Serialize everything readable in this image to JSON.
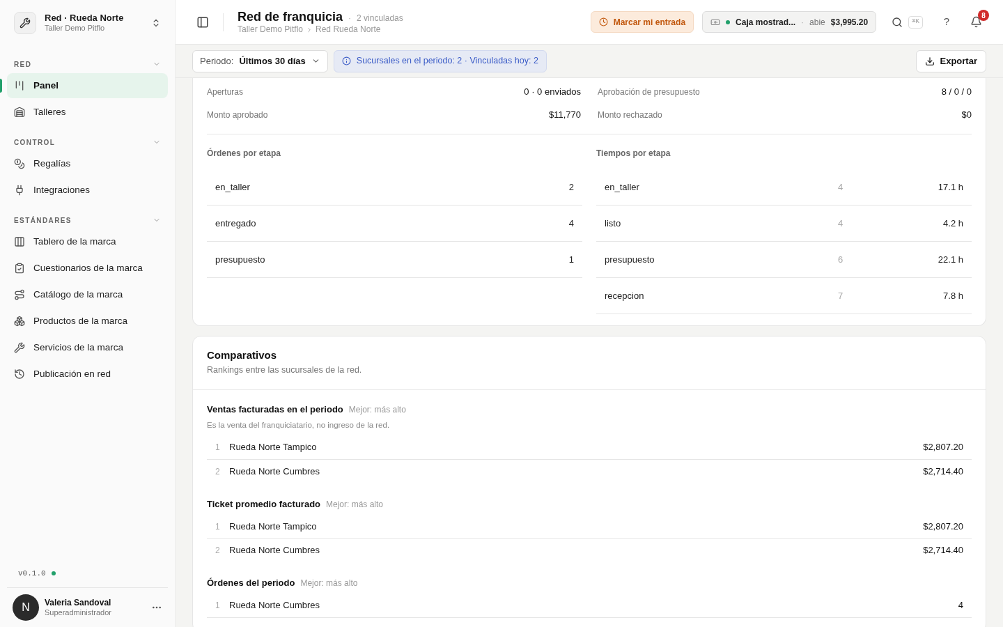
{
  "sidebar": {
    "org": {
      "title": "Red · Rueda Norte",
      "subtitle": "Taller Demo Pitflo"
    },
    "sections": [
      {
        "label": "RED",
        "expanded": true,
        "items": [
          {
            "label": "Panel",
            "selected": true
          },
          {
            "label": "Talleres",
            "selected": false
          }
        ]
      },
      {
        "label": "CONTROL",
        "expanded": true,
        "items": [
          {
            "label": "Regalías",
            "selected": false
          },
          {
            "label": "Integraciones",
            "selected": false
          }
        ]
      },
      {
        "label": "ESTÁNDARES",
        "expanded": true,
        "items": [
          {
            "label": "Tablero de la marca",
            "selected": false
          },
          {
            "label": "Cuestionarios de la marca",
            "selected": false
          },
          {
            "label": "Catálogo de la marca",
            "selected": false
          },
          {
            "label": "Productos de la marca",
            "selected": false
          },
          {
            "label": "Servicios de la marca",
            "selected": false
          },
          {
            "label": "Publicación en red",
            "selected": false
          }
        ]
      }
    ],
    "version": "v0.1.0",
    "user": {
      "initial": "N",
      "name": "Valeria Sandoval",
      "role": "Superadministrador"
    }
  },
  "header": {
    "title": "Red de franquicia",
    "separator": "·",
    "count": "2 vinculadas",
    "breadcrumb": [
      "Taller Demo Pitflo",
      "Red Rueda Norte"
    ],
    "clock_in": "Marcar mi entrada",
    "cash": {
      "name": "Caja mostrad...",
      "separator": "·",
      "status": "abie",
      "amount": "$3,995.20"
    },
    "shortcut": "⌘K",
    "help": "?",
    "notifications": "8"
  },
  "toolbar": {
    "period_label": "Periodo:",
    "period_value": "Últimos 30 días",
    "info": "Sucursales en el periodo: 2 · Vinculadas hoy: 2",
    "export": "Exportar"
  },
  "metrics": [
    [
      {
        "label": "Aperturas",
        "value": "0 · 0 enviados"
      },
      {
        "label": "Monto aprobado",
        "value": "$11,770"
      }
    ],
    [
      {
        "label": "Aprobación de presupuesto",
        "value": "8 / 0 / 0"
      },
      {
        "label": "Monto rechazado",
        "value": "$0"
      }
    ]
  ],
  "orders_by_stage": {
    "title": "Órdenes por etapa",
    "rows": [
      {
        "stage": "en_taller",
        "count": "2"
      },
      {
        "stage": "entregado",
        "count": "4"
      },
      {
        "stage": "presupuesto",
        "count": "1"
      }
    ]
  },
  "times_by_stage": {
    "title": "Tiempos por etapa",
    "rows": [
      {
        "stage": "en_taller",
        "count": "4",
        "time": "17.1 h"
      },
      {
        "stage": "listo",
        "count": "4",
        "time": "4.2 h"
      },
      {
        "stage": "presupuesto",
        "count": "6",
        "time": "22.1 h"
      },
      {
        "stage": "recepcion",
        "count": "7",
        "time": "7.8 h"
      }
    ]
  },
  "comparatives": {
    "title": "Comparativos",
    "subtitle": "Rankings entre las sucursales de la red.",
    "rankings": [
      {
        "title": "Ventas facturadas en el periodo",
        "criterion": "Mejor: más alto",
        "note": "Es la venta del franquiciatario, no ingreso de la red.",
        "rows": [
          {
            "rank": "1",
            "name": "Rueda Norte Tampico",
            "value": "$2,807.20"
          },
          {
            "rank": "2",
            "name": "Rueda Norte Cumbres",
            "value": "$2,714.40"
          }
        ]
      },
      {
        "title": "Ticket promedio facturado",
        "criterion": "Mejor: más alto",
        "rows": [
          {
            "rank": "1",
            "name": "Rueda Norte Tampico",
            "value": "$2,807.20"
          },
          {
            "rank": "2",
            "name": "Rueda Norte Cumbres",
            "value": "$2,714.40"
          }
        ]
      },
      {
        "title": "Órdenes del periodo",
        "criterion": "Mejor: más alto",
        "rows": [
          {
            "rank": "1",
            "name": "Rueda Norte Cumbres",
            "value": "4"
          }
        ]
      }
    ]
  }
}
